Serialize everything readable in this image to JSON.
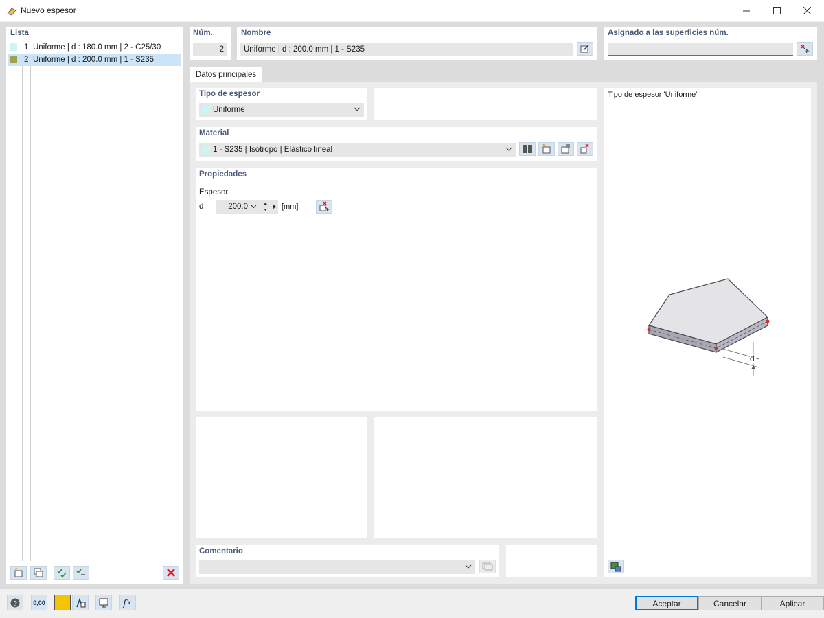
{
  "window": {
    "title": "Nuevo espesor"
  },
  "list": {
    "label": "Lista",
    "items": [
      {
        "num": "1",
        "text": "Uniforme | d : 180.0 mm | 2 - C25/30",
        "color": "#ccf5f5"
      },
      {
        "num": "2",
        "text": "Uniforme | d : 200.0 mm | 1 - S235",
        "color": "#a0a050"
      }
    ]
  },
  "num": {
    "label": "Núm.",
    "value": "2"
  },
  "nombre": {
    "label": "Nombre",
    "value": "Uniforme | d : 200.0 mm | 1 - S235"
  },
  "asignado": {
    "label": "Asignado a las superficies núm.",
    "value": ""
  },
  "tabs": [
    {
      "label": "Datos principales"
    }
  ],
  "tipo": {
    "label": "Tipo de espesor",
    "value": "Uniforme",
    "color": "#ccf5f5"
  },
  "material": {
    "label": "Material",
    "value": "1 - S235 | Isótropo | Elástico lineal",
    "color": "#ccf5f5"
  },
  "propiedades": {
    "label": "Propiedades",
    "espesor_label": "Espesor",
    "d_label": "d",
    "d_value": "200.0",
    "unit": "[mm]"
  },
  "preview": {
    "title": "Tipo de espesor  'Uniforme'",
    "dim_label": "d"
  },
  "comentario": {
    "label": "Comentario",
    "value": ""
  },
  "buttons": {
    "aceptar": "Aceptar",
    "cancelar": "Cancelar",
    "aplicar": "Aplicar"
  },
  "toolbar": {
    "units_label": "0,00"
  },
  "colors": {
    "accent": "#0078d7",
    "section_label": "#4a5a78",
    "selection": "#cce4f7",
    "delete": "#e81123"
  }
}
